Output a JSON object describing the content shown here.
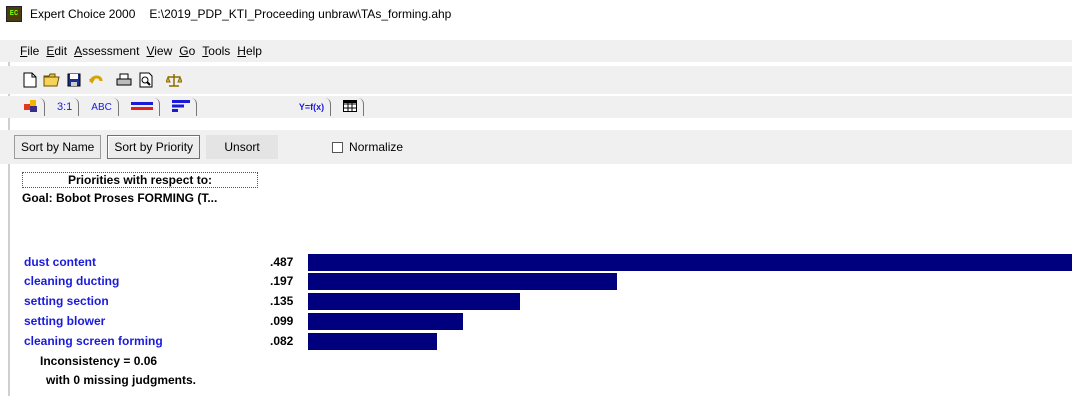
{
  "window": {
    "app_name": "Expert Choice 2000",
    "file_path": "E:\\2019_PDP_KTI_Proceeding unbraw\\TAs_forming.ahp",
    "icon_text": "EC"
  },
  "menu": [
    {
      "hot": "F",
      "rest": "ile"
    },
    {
      "hot": "E",
      "rest": "dit"
    },
    {
      "hot": "A",
      "rest": "ssessment"
    },
    {
      "hot": "V",
      "rest": "iew"
    },
    {
      "hot": "G",
      "rest": "o"
    },
    {
      "hot": "T",
      "rest": "ools"
    },
    {
      "hot": "H",
      "rest": "elp"
    }
  ],
  "toolbar_icons": [
    "new-file-icon",
    "open-folder-icon",
    "save-disk-icon",
    "undo-icon",
    "print-icon",
    "print-preview-icon",
    "balance-scale-icon"
  ],
  "mode_tabs": {
    "pairwise_numeric": "3:1",
    "verbal": "ABC",
    "formula": "Y=f(x)"
  },
  "sort_bar": {
    "sort_by_name": "Sort by Name",
    "sort_by_priority": "Sort by Priority",
    "unsort": "Unsort",
    "normalize": "Normalize",
    "normalize_checked": false
  },
  "priorities": {
    "header": "Priorities with respect to:",
    "goal": "Goal: Bobot Proses FORMING (T...",
    "bar_color": "#00007f",
    "label_color": "#1a1adb",
    "items": [
      {
        "label": "dust content",
        "value": ".487",
        "weight": 0.487
      },
      {
        "label": "cleaning ducting",
        "value": ".197",
        "weight": 0.197
      },
      {
        "label": "setting section",
        "value": ".135",
        "weight": 0.135
      },
      {
        "label": "setting blower",
        "value": ".099",
        "weight": 0.099
      },
      {
        "label": "cleaning screen forming",
        "value": ".082",
        "weight": 0.082
      }
    ],
    "inconsistency": "Inconsistency = 0.06",
    "missing": "with 0  missing judgments."
  }
}
